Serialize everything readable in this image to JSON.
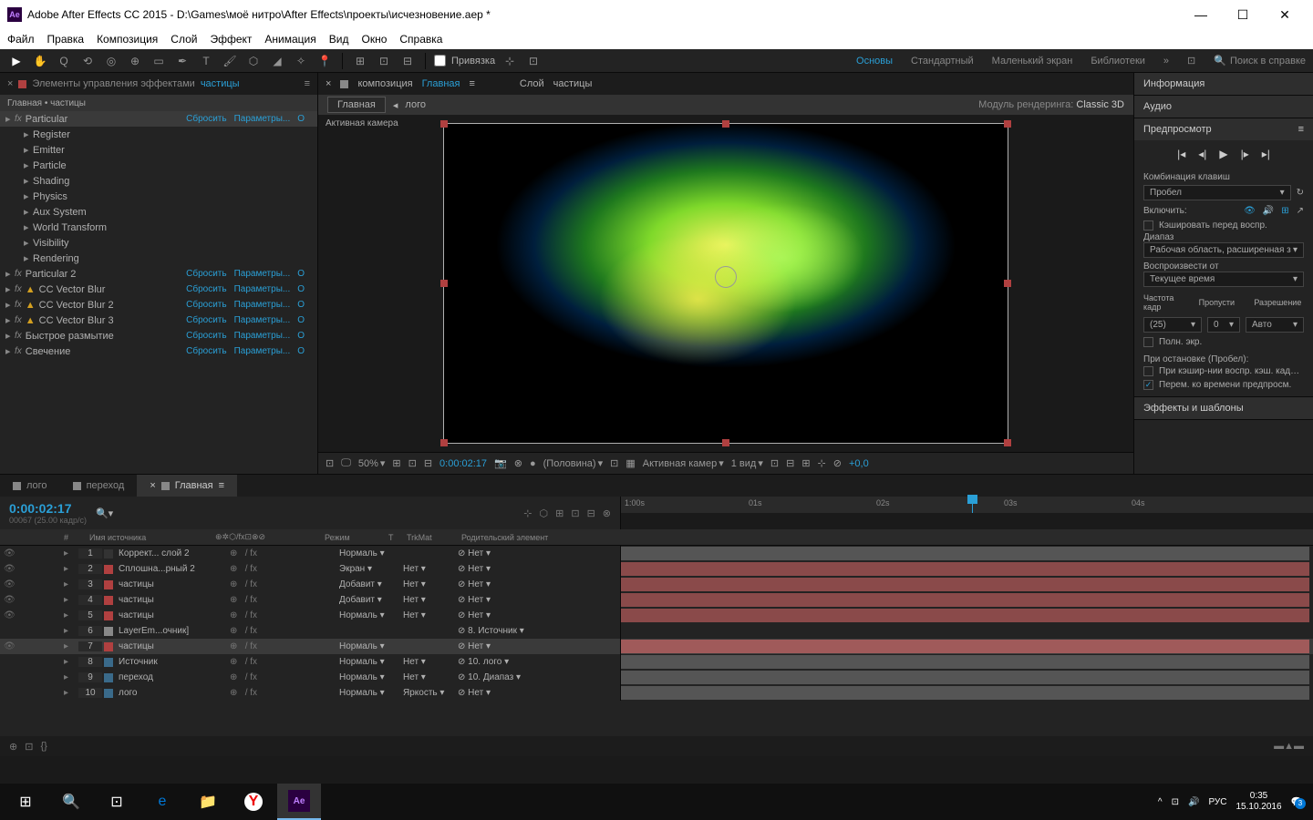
{
  "titlebar": {
    "app_icon": "Ae",
    "title": "Adobe After Effects CC 2015 - D:\\Games\\моё нитро\\After Effects\\проекты\\исчезновение.aep *"
  },
  "menubar": [
    "Файл",
    "Правка",
    "Композиция",
    "Слой",
    "Эффект",
    "Анимация",
    "Вид",
    "Окно",
    "Справка"
  ],
  "toolbar": {
    "snap_label": "Привязка",
    "workspaces": [
      "Основы",
      "Стандартный",
      "Маленький экран",
      "Библиотеки"
    ],
    "search_placeholder": "Поиск в справке"
  },
  "effects_panel": {
    "tab_prefix": "Элементы управления эффектами",
    "tab_layer": "частицы",
    "breadcrumb": "Главная • частицы",
    "reset": "Сбросить",
    "options": "Параметры...",
    "about": "О",
    "effects": [
      {
        "name": "Particular",
        "sub": true
      },
      {
        "name": "Particular 2"
      },
      {
        "name": "CC Vector Blur",
        "warn": true
      },
      {
        "name": "CC Vector Blur 2",
        "warn": true
      },
      {
        "name": "CC Vector Blur 3",
        "warn": true
      },
      {
        "name": "Быстрое размытие"
      },
      {
        "name": "Свечение"
      }
    ],
    "sub_params": [
      "Register",
      "Emitter",
      "Particle",
      "Shading",
      "Physics",
      "Aux System",
      "World Transform",
      "Visibility",
      "Rendering"
    ]
  },
  "comp_panel": {
    "tabs": [
      {
        "label": "композиция",
        "name": "Главная",
        "color": "#888"
      },
      {
        "label": "Слой",
        "name": "частицы",
        "color": "#b04040"
      }
    ],
    "crumb_main": "Главная",
    "crumb_sub": "лого",
    "renderer_label": "Модуль рендеринга:",
    "renderer": "Classic 3D",
    "camera_label": "Активная камера",
    "footer": {
      "zoom": "50%",
      "time": "0:00:02:17",
      "res": "(Половина)",
      "view": "Активная камер",
      "views": "1 вид",
      "offset": "+0,0"
    }
  },
  "right_panel": {
    "info": "Информация",
    "audio": "Аудио",
    "preview": "Предпросмотр",
    "shortcut_label": "Комбинация клавиш",
    "shortcut": "Пробел",
    "include": "Включить:",
    "cache": "Кэшировать перед воспр.",
    "range_label": "Диапаз",
    "range": "Рабочая область, расширенная з",
    "play_from_label": "Воспроизвести от",
    "play_from": "Текущее время",
    "fps_label": "Частота кадр",
    "skip_label": "Пропусти",
    "res_label": "Разрешение",
    "fps": "(25)",
    "skip": "0",
    "res": "Авто",
    "fullscreen": "Полн. экр.",
    "stop_label": "При остановке (Пробел):",
    "stop1": "При кэшир-нии воспр. кэш. кад…",
    "stop2": "Перем. ко времени предпросм.",
    "effects_presets": "Эффекты и шаблоны"
  },
  "timeline": {
    "tabs": [
      "лого",
      "переход",
      "Главная"
    ],
    "timecode": "0:00:02:17",
    "subtime": "00067 (25.00 кадр/c)",
    "ruler": [
      "1:00s",
      "01s",
      "02s",
      "03s",
      "04s"
    ],
    "cols": {
      "name": "Имя источника",
      "mode": "Режим",
      "t": "T",
      "trkmat": "TrkMat",
      "parent": "Родительский элемент"
    },
    "layers": [
      {
        "n": 1,
        "color": "#333",
        "name": "Коррект... слой 2",
        "mode": "Нормаль",
        "trk": "",
        "par": "Нет",
        "bar": "gray",
        "vis": true
      },
      {
        "n": 2,
        "color": "#b04040",
        "name": "Сплошна...рный 2",
        "mode": "Экран",
        "trk": "Нет",
        "par": "Нет",
        "bar": "red",
        "vis": true
      },
      {
        "n": 3,
        "color": "#b04040",
        "name": "частицы",
        "mode": "Добавит",
        "trk": "Нет",
        "par": "Нет",
        "bar": "red",
        "vis": true
      },
      {
        "n": 4,
        "color": "#b04040",
        "name": "частицы",
        "mode": "Добавит",
        "trk": "Нет",
        "par": "Нет",
        "bar": "red",
        "vis": true
      },
      {
        "n": 5,
        "color": "#b04040",
        "name": "частицы",
        "mode": "Нормаль",
        "trk": "Нет",
        "par": "Нет",
        "bar": "red",
        "vis": true
      },
      {
        "n": 6,
        "color": "#888",
        "name": "LayerEm...очник]",
        "mode": "",
        "trk": "",
        "par": "8. Источник",
        "bar": "",
        "vis": false
      },
      {
        "n": 7,
        "color": "#b04040",
        "name": "частицы",
        "mode": "Нормаль",
        "trk": "",
        "par": "Нет",
        "bar": "pink",
        "vis": true,
        "sel": true
      },
      {
        "n": 8,
        "color": "#3a6a8a",
        "name": "Источник",
        "mode": "Нормаль",
        "trk": "Нет",
        "par": "10. лого",
        "bar": "gray",
        "vis": false
      },
      {
        "n": 9,
        "color": "#3a6a8a",
        "name": "переход",
        "mode": "Нормаль",
        "trk": "Нет",
        "par": "10. Диапаз",
        "bar": "gray",
        "vis": false
      },
      {
        "n": 10,
        "color": "#3a6a8a",
        "name": "лого",
        "mode": "Нормаль",
        "trk": "Яркость",
        "par": "Нет",
        "bar": "gray",
        "vis": false
      }
    ]
  },
  "taskbar": {
    "lang": "РУС",
    "time": "0:35",
    "date": "15.10.2016",
    "notif": "3"
  }
}
